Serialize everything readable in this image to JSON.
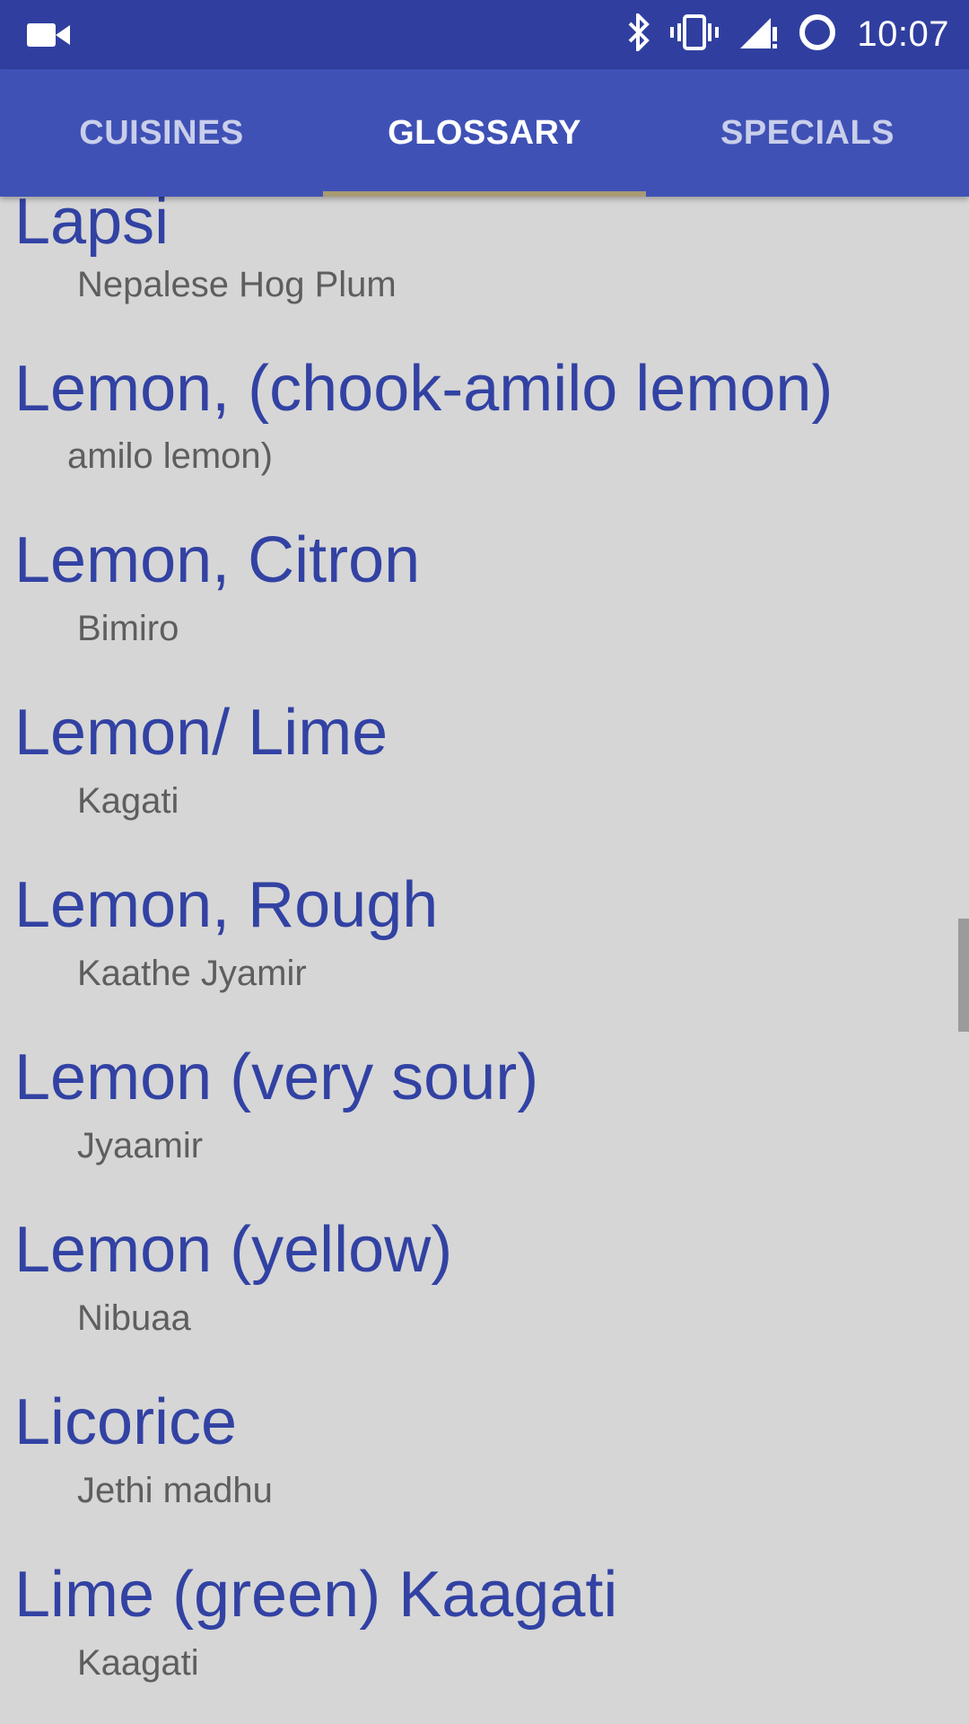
{
  "status_bar": {
    "time": "10:07",
    "icons": [
      "video-camera-icon",
      "bluetooth-icon",
      "vibrate-icon",
      "signal-icon",
      "sync-icon"
    ]
  },
  "tabs": [
    {
      "label": "CUISINES",
      "active": false
    },
    {
      "label": "GLOSSARY",
      "active": true
    },
    {
      "label": "SPECIALS",
      "active": false
    }
  ],
  "glossary": {
    "entries": [
      {
        "term": "Lapsi",
        "translation": "Nepalese Hog Plum"
      },
      {
        "term": "Lemon, (chook-amilo lemon)",
        "translation": "amilo lemon)"
      },
      {
        "term": "Lemon, Citron",
        "translation": "Bimiro"
      },
      {
        "term": "Lemon/ Lime",
        "translation": "Kagati"
      },
      {
        "term": "Lemon, Rough",
        "translation": "Kaathe Jyamir"
      },
      {
        "term": "Lemon (very sour)",
        "translation": "Jyaamir"
      },
      {
        "term": "Lemon (yellow)",
        "translation": "Nibuaa"
      },
      {
        "term": "Licorice",
        "translation": "Jethi madhu"
      },
      {
        "term": "Lime (green) Kaagati",
        "translation": "Kaagati"
      }
    ]
  },
  "colors": {
    "status_bar": "#303f9f",
    "tab_bar": "#3f51b5",
    "term_text": "#3242a3",
    "translation_text": "#5e5e5e",
    "background": "#d6d6d6",
    "tab_indicator": "#a89a72"
  }
}
